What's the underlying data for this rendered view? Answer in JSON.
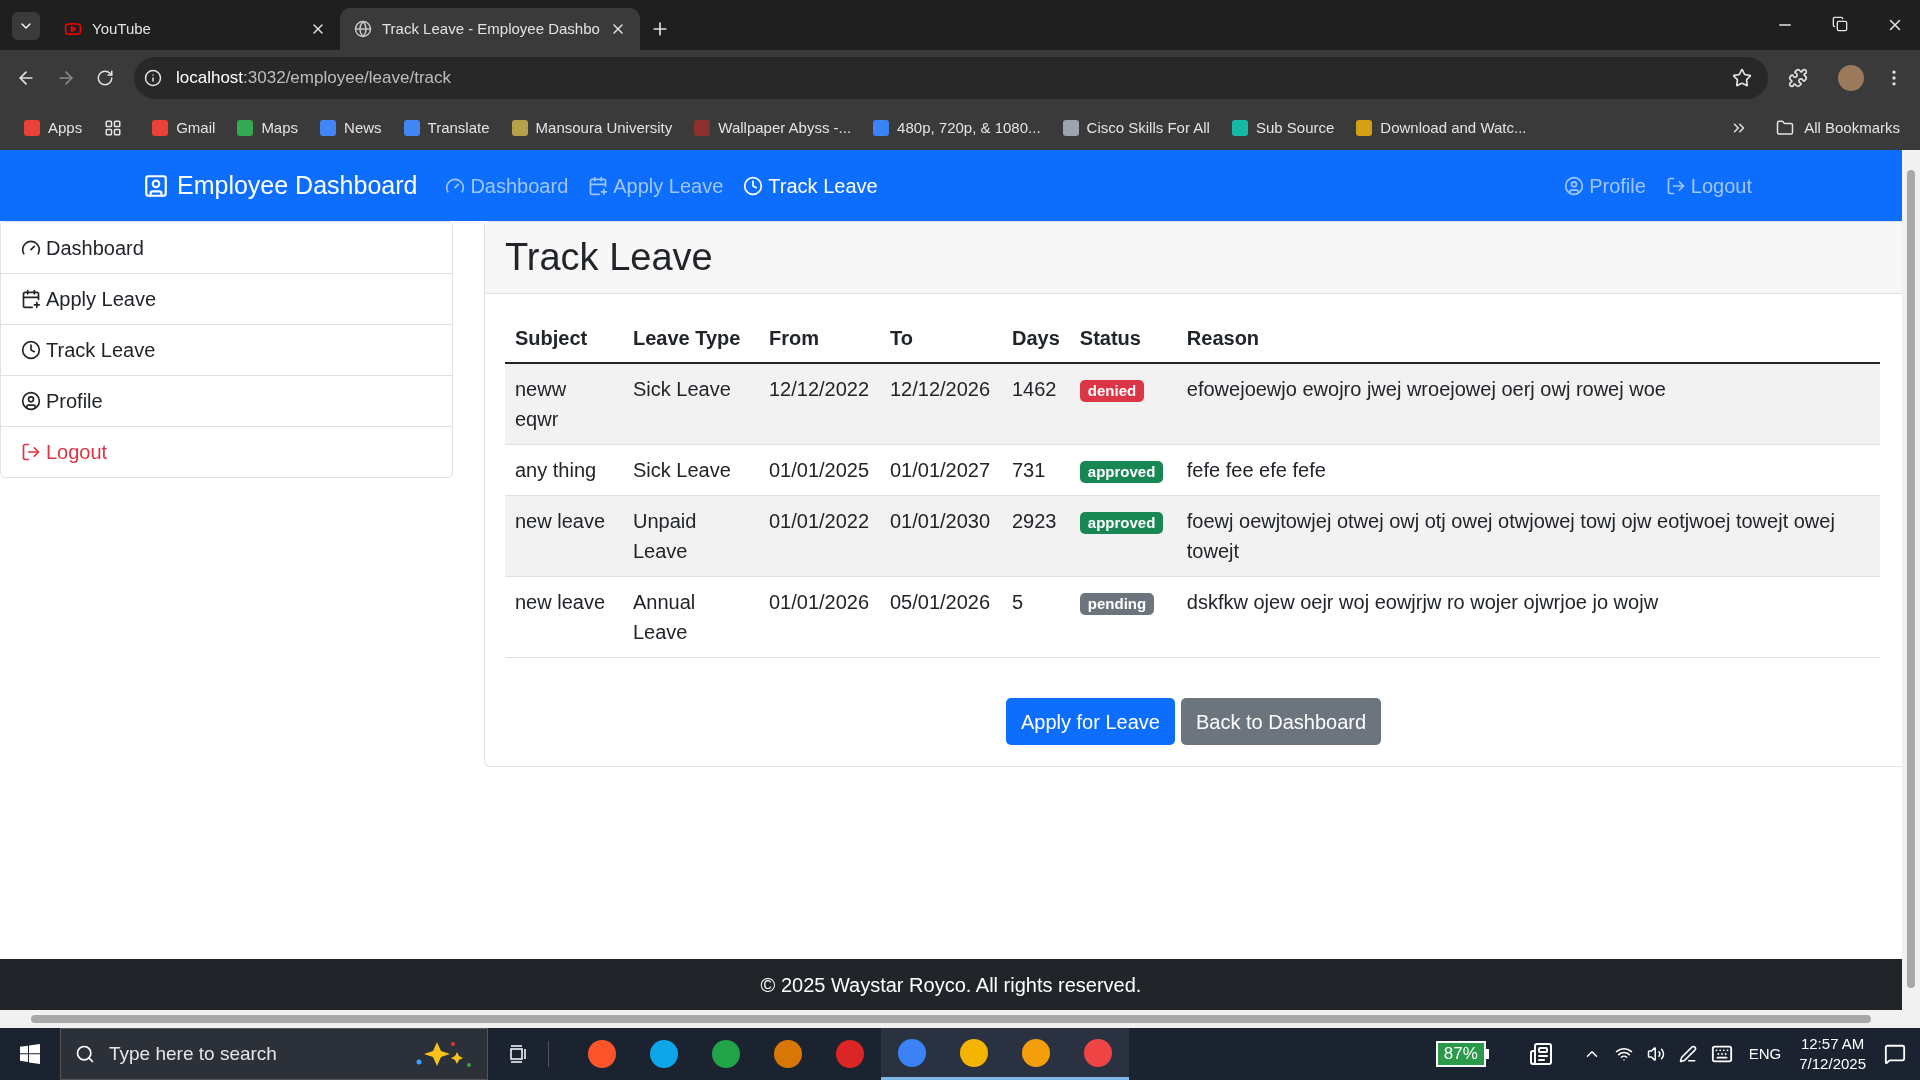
{
  "browser": {
    "tabs": [
      {
        "title": "YouTube",
        "kind": "youtube",
        "selected": false
      },
      {
        "title": "Track Leave - Employee Dashbo",
        "kind": "globe",
        "selected": true
      }
    ],
    "url_host": "localhost",
    "url_path": ":3032/employee/leave/track",
    "bookmarks": [
      {
        "label": "Apps",
        "color": "#ea4335"
      },
      {
        "label": "Gmail",
        "color": "#ea4335"
      },
      {
        "label": "Maps",
        "color": "#34a853"
      },
      {
        "label": "News",
        "color": "#4285f4"
      },
      {
        "label": "Translate",
        "color": "#4285f4"
      },
      {
        "label": "Mansoura University",
        "color": "#b8a04a"
      },
      {
        "label": "Wallpaper Abyss -...",
        "color": "#8a3030"
      },
      {
        "label": "480p, 720p, & 1080...",
        "color": "#3b82f6"
      },
      {
        "label": "Cisco Skills For All",
        "color": "#9ca3af"
      },
      {
        "label": "Sub Source",
        "color": "#14b8a6"
      },
      {
        "label": "Download and Watc...",
        "color": "#d4a017"
      }
    ],
    "all_bookmarks": "All Bookmarks"
  },
  "navbar": {
    "brand": "Employee Dashboard",
    "items": [
      {
        "label": "Dashboard",
        "selected": false
      },
      {
        "label": "Apply Leave",
        "selected": false
      },
      {
        "label": "Track Leave",
        "selected": true
      }
    ],
    "right_items": [
      {
        "label": "Profile"
      },
      {
        "label": "Logout"
      }
    ]
  },
  "sidebar": {
    "items": [
      {
        "label": "Dashboard",
        "kind": "default"
      },
      {
        "label": "Apply Leave",
        "kind": "default"
      },
      {
        "label": "Track Leave",
        "kind": "default"
      },
      {
        "label": "Profile",
        "kind": "default"
      },
      {
        "label": "Logout",
        "kind": "danger"
      }
    ]
  },
  "card": {
    "title": "Track Leave",
    "table": {
      "columns": [
        "Subject",
        "Leave Type",
        "From",
        "To",
        "Days",
        "Status",
        "Reason"
      ],
      "rows": [
        {
          "subject": "neww eqwr",
          "leave_type": "Sick Leave",
          "from": "12/12/2022",
          "to": "12/12/2026",
          "days": "1462",
          "status": "denied",
          "color": "#dc3545",
          "reason": "efowejoewjo ewojro jwej wroejowej oerj owj rowej woe"
        },
        {
          "subject": "any thing",
          "leave_type": "Sick Leave",
          "from": "01/01/2025",
          "to": "01/01/2027",
          "days": "731",
          "status": "approved",
          "color": "#198754",
          "reason": "fefe fee efe fefe"
        },
        {
          "subject": "new leave",
          "leave_type": "Unpaid Leave",
          "from": "01/01/2022",
          "to": "01/01/2030",
          "days": "2923",
          "status": "approved",
          "color": "#198754",
          "reason": "foewj oewjtowjej otwej owj otj owej otwjowej towj ojw eotjwoej towejt owej towejt"
        },
        {
          "subject": "new leave",
          "leave_type": "Annual Leave",
          "from": "01/01/2026",
          "to": "05/01/2026",
          "days": "5",
          "status": "pending",
          "color": "#6c757d",
          "reason": "dskfkw ojew oejr woj eowjrjw ro wojer ojwrjoe jo wojw"
        }
      ]
    },
    "buttons": [
      {
        "label": "Apply for Leave",
        "kind": "primary"
      },
      {
        "label": "Back to Dashboard",
        "kind": "secondary"
      }
    ]
  },
  "footer": "© 2025 Waystar Royco. All rights reserved.",
  "taskbar": {
    "search_placeholder": "Type here to search",
    "apps": [
      {
        "color": "#fb542b",
        "selected": false
      },
      {
        "color": "#0ea5e9",
        "selected": false
      },
      {
        "color": "#22a34a",
        "selected": false
      },
      {
        "color": "#d97706",
        "selected": false
      },
      {
        "color": "#dc2626",
        "selected": false
      },
      {
        "color": "#3b82f6",
        "selected": true
      },
      {
        "color": "#f4b400",
        "selected": true
      },
      {
        "color": "#f59e0b",
        "selected": true
      },
      {
        "color": "#ef4444",
        "selected": true
      }
    ],
    "battery": "87%",
    "language": "ENG",
    "time": "12:57 AM",
    "date": "7/12/2025"
  }
}
